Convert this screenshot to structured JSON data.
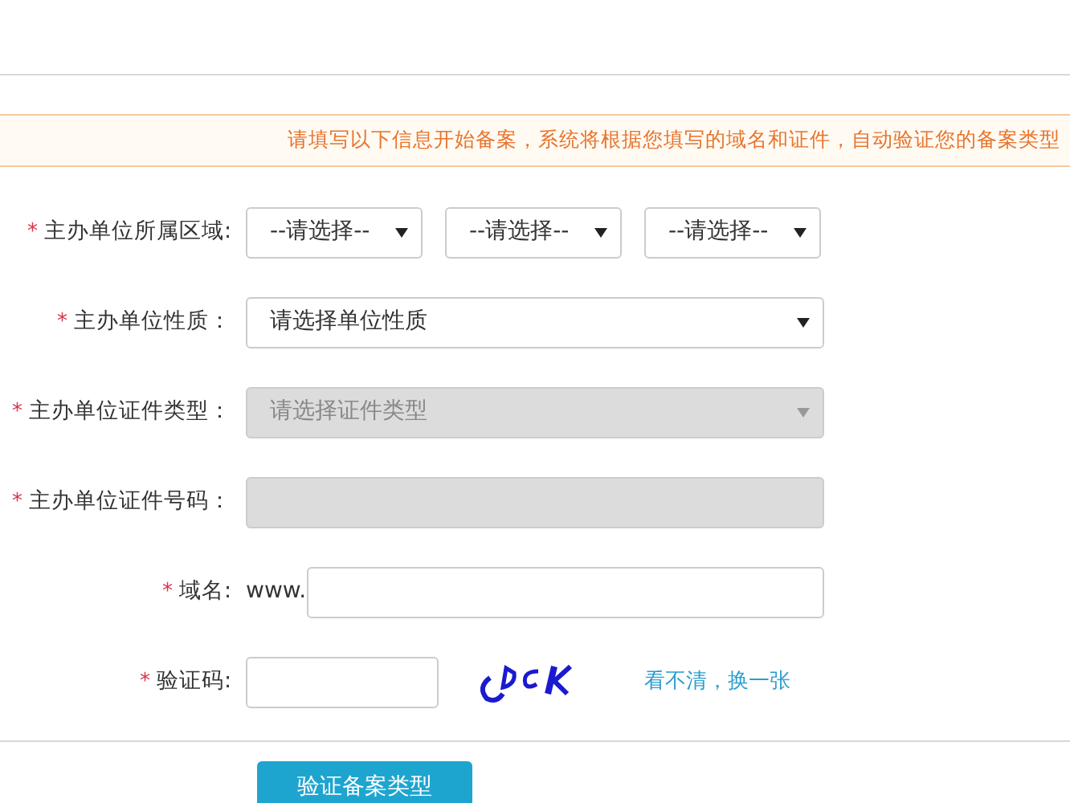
{
  "notice": "请填写以下信息开始备案，系统将根据您填写的域名和证件，自动验证您的备案类型",
  "fields": [
    {
      "kind": "region",
      "required_mark": "*",
      "label": "主办单位所属区域:",
      "selects": [
        {
          "value": "--请选择--",
          "disabled": false
        },
        {
          "value": "--请选择--",
          "disabled": false
        },
        {
          "value": "--请选择--",
          "disabled": false
        }
      ]
    },
    {
      "kind": "select",
      "required_mark": "*",
      "label": "主办单位性质：",
      "value": "请选择单位性质",
      "disabled": false
    },
    {
      "kind": "select",
      "required_mark": "*",
      "label": "主办单位证件类型：",
      "value": "请选择证件类型",
      "disabled": true
    },
    {
      "kind": "text",
      "required_mark": "*",
      "label": "主办单位证件号码：",
      "disabled": true
    },
    {
      "kind": "domain",
      "required_mark": "*",
      "label": "域名:",
      "prefix": "www."
    },
    {
      "kind": "captcha",
      "required_mark": "*",
      "label": "验证码:",
      "refresh_link": "看不清，换一张"
    }
  ],
  "submit": "验证备案类型"
}
